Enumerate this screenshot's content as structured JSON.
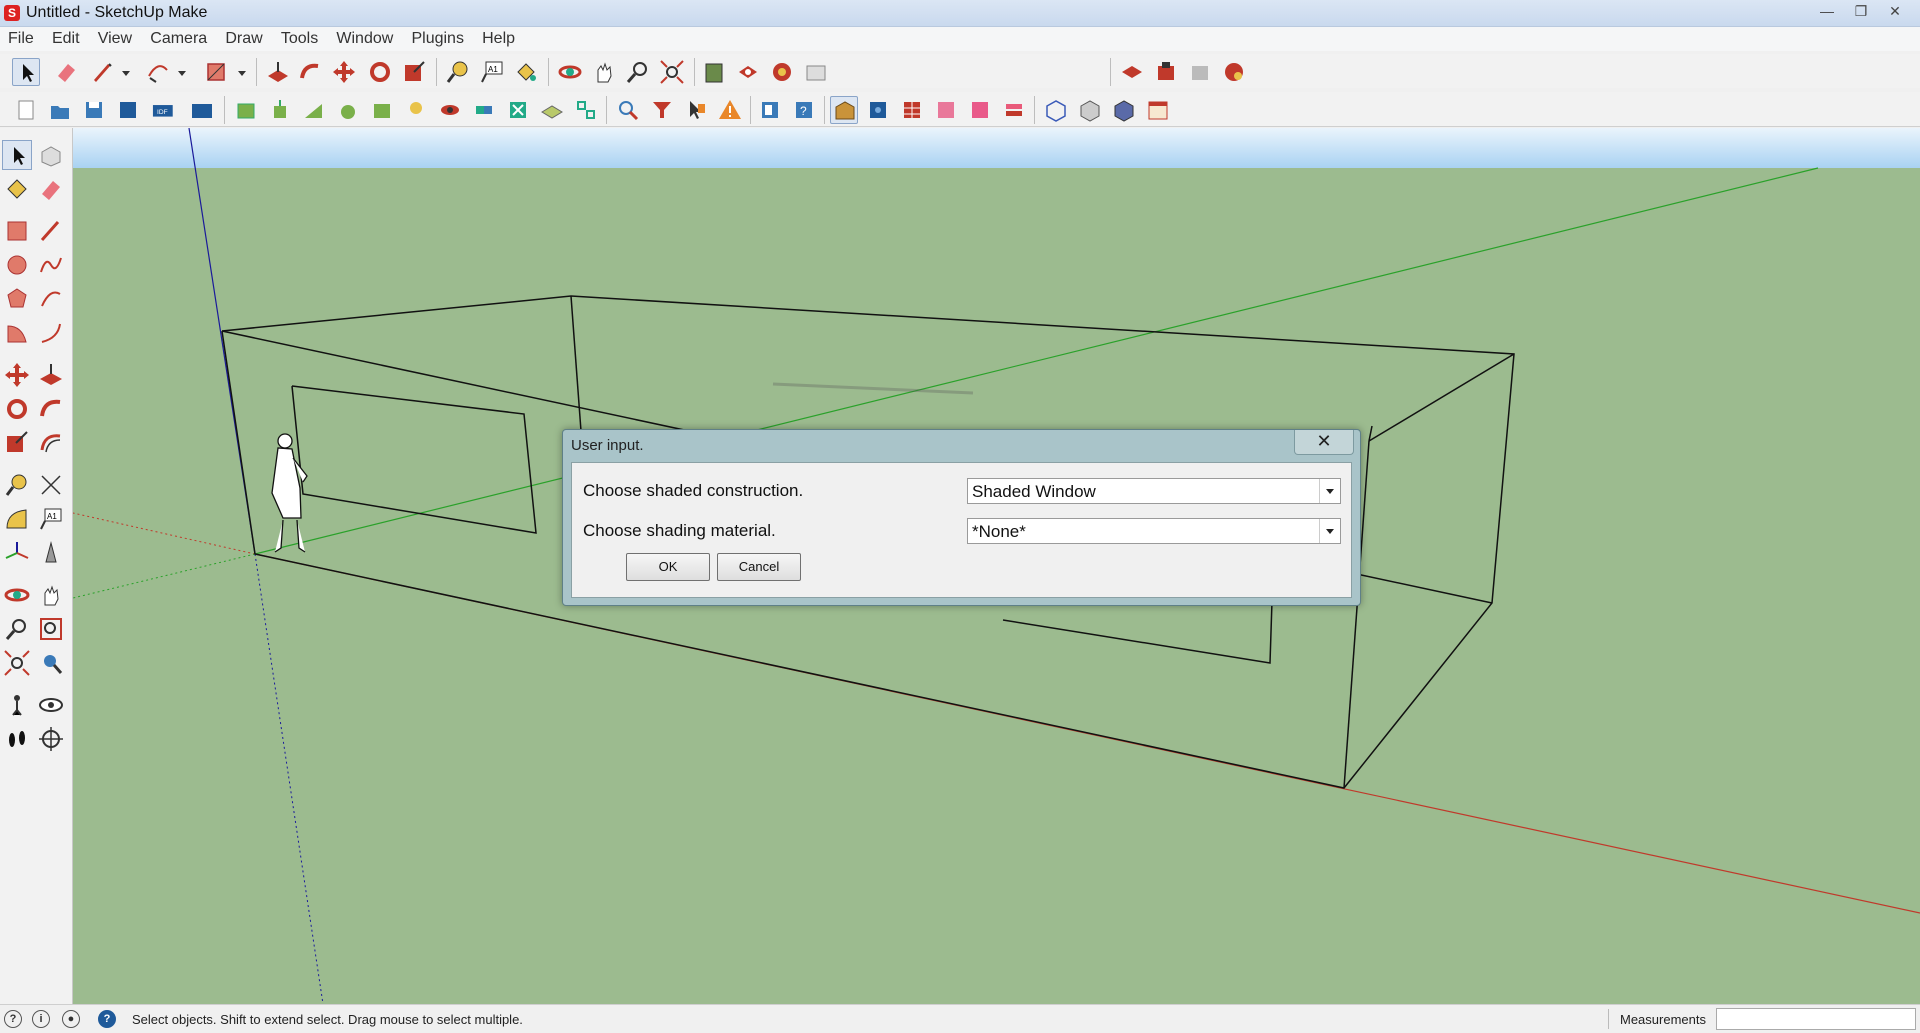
{
  "window": {
    "title": "Untitled - SketchUp Make",
    "app_icon": "S"
  },
  "menu": [
    "File",
    "Edit",
    "View",
    "Camera",
    "Draw",
    "Tools",
    "Window",
    "Plugins",
    "Help"
  ],
  "dialog": {
    "title": "User input.",
    "close_label": "✕",
    "fields": [
      {
        "label": "Choose shaded construction.",
        "value": "Shaded Window"
      },
      {
        "label": "Choose shading material.",
        "value": "*None*"
      }
    ],
    "ok_label": "OK",
    "cancel_label": "Cancel"
  },
  "status": {
    "hint": "Select objects. Shift to extend select. Drag mouse to select multiple.",
    "measurements_label": "Measurements",
    "measurements_value": ""
  },
  "colors": {
    "sky": "#d5ebfb",
    "ground": "#9cbb8f",
    "axis_red": "#c0392b",
    "axis_green": "#2aa12a",
    "axis_blue": "#1a1a9a"
  }
}
